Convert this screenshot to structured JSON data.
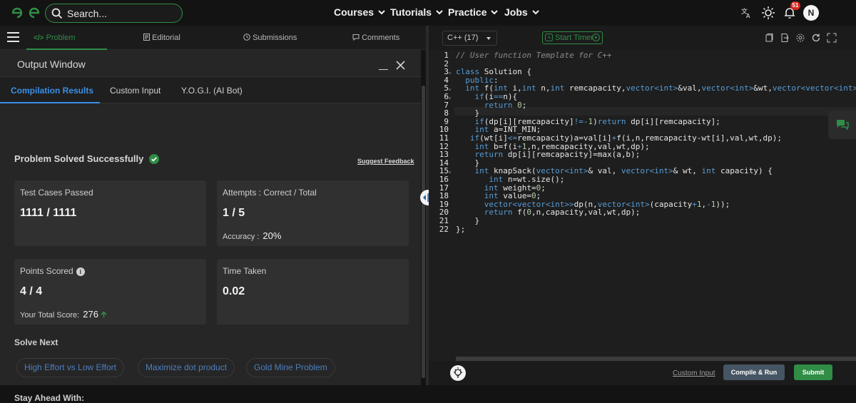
{
  "header": {
    "search_placeholder": "Search...",
    "nav": [
      {
        "label": "Courses"
      },
      {
        "label": "Tutorials"
      },
      {
        "label": "Practice"
      },
      {
        "label": "Jobs"
      }
    ],
    "notification_count": "51",
    "avatar_initial": "N",
    "brand_color": "#2f8d46"
  },
  "left_tabs": [
    {
      "label": "Problem",
      "icon": "code-icon",
      "active": true
    },
    {
      "label": "Editorial",
      "icon": "document-icon"
    },
    {
      "label": "Submissions",
      "icon": "clock-icon"
    },
    {
      "label": "Comments",
      "icon": "chat-icon"
    }
  ],
  "output": {
    "title": "Output Window",
    "tabs": [
      {
        "label": "Compilation Results",
        "active": true
      },
      {
        "label": "Custom Input"
      },
      {
        "label": "Y.O.G.I. (AI Bot)"
      }
    ],
    "status": "Problem Solved Successfully",
    "feedback_link": "Suggest Feedback",
    "cards": {
      "test_cases": {
        "label": "Test Cases Passed",
        "value": "1111 / 1111"
      },
      "attempts": {
        "label": "Attempts : Correct / Total",
        "value": "1 / 5",
        "accuracy_label": "Accuracy :",
        "accuracy_value": "20%"
      },
      "points": {
        "label": "Points Scored",
        "value": "4 / 4",
        "total_label": "Your Total Score:",
        "total_value": "276"
      },
      "time": {
        "label": "Time Taken",
        "value": "0.02"
      }
    },
    "solve_next_heading": "Solve Next",
    "solve_next": [
      "High Effort vs Low Effort",
      "Maximize dot product",
      "Gold Mine Problem"
    ],
    "stay_ahead_heading": "Stay Ahead With:"
  },
  "editor": {
    "language": "C++ (17)",
    "timer_label": "Start Timer",
    "code_lines": [
      "// User function Template for C++",
      "",
      "class Solution {",
      "  public:",
      "  int f(int i,int n,int remcapacity,vector<int>&val,vector<int>&wt,vector<vector<int>>&dp){",
      "    if(i==n){",
      "      return 0;",
      "    }",
      "    if(dp[i][remcapacity]!=-1)return dp[i][remcapacity];",
      "    int a=INT_MIN;",
      "   if(wt[i]<=remcapacity)a=val[i]+f(i,n,remcapacity-wt[i],val,wt,dp);",
      "    int b=f(i+1,n,remcapacity,val,wt,dp);",
      "    return dp[i][remcapacity]=max(a,b);",
      "    }",
      "    int knapSack(vector<int>& val, vector<int>& wt, int capacity) {",
      "       int n=wt.size();",
      "      int weight=0;",
      "      int value=0;",
      "      vector<vector<int>>dp(n,vector<int>(capacity+1,-1));",
      "      return f(0,n,capacity,val,wt,dp);",
      "    }",
      "};"
    ],
    "custom_input_link": "Custom Input",
    "compile_run_label": "Compile & Run",
    "submit_label": "Submit"
  }
}
